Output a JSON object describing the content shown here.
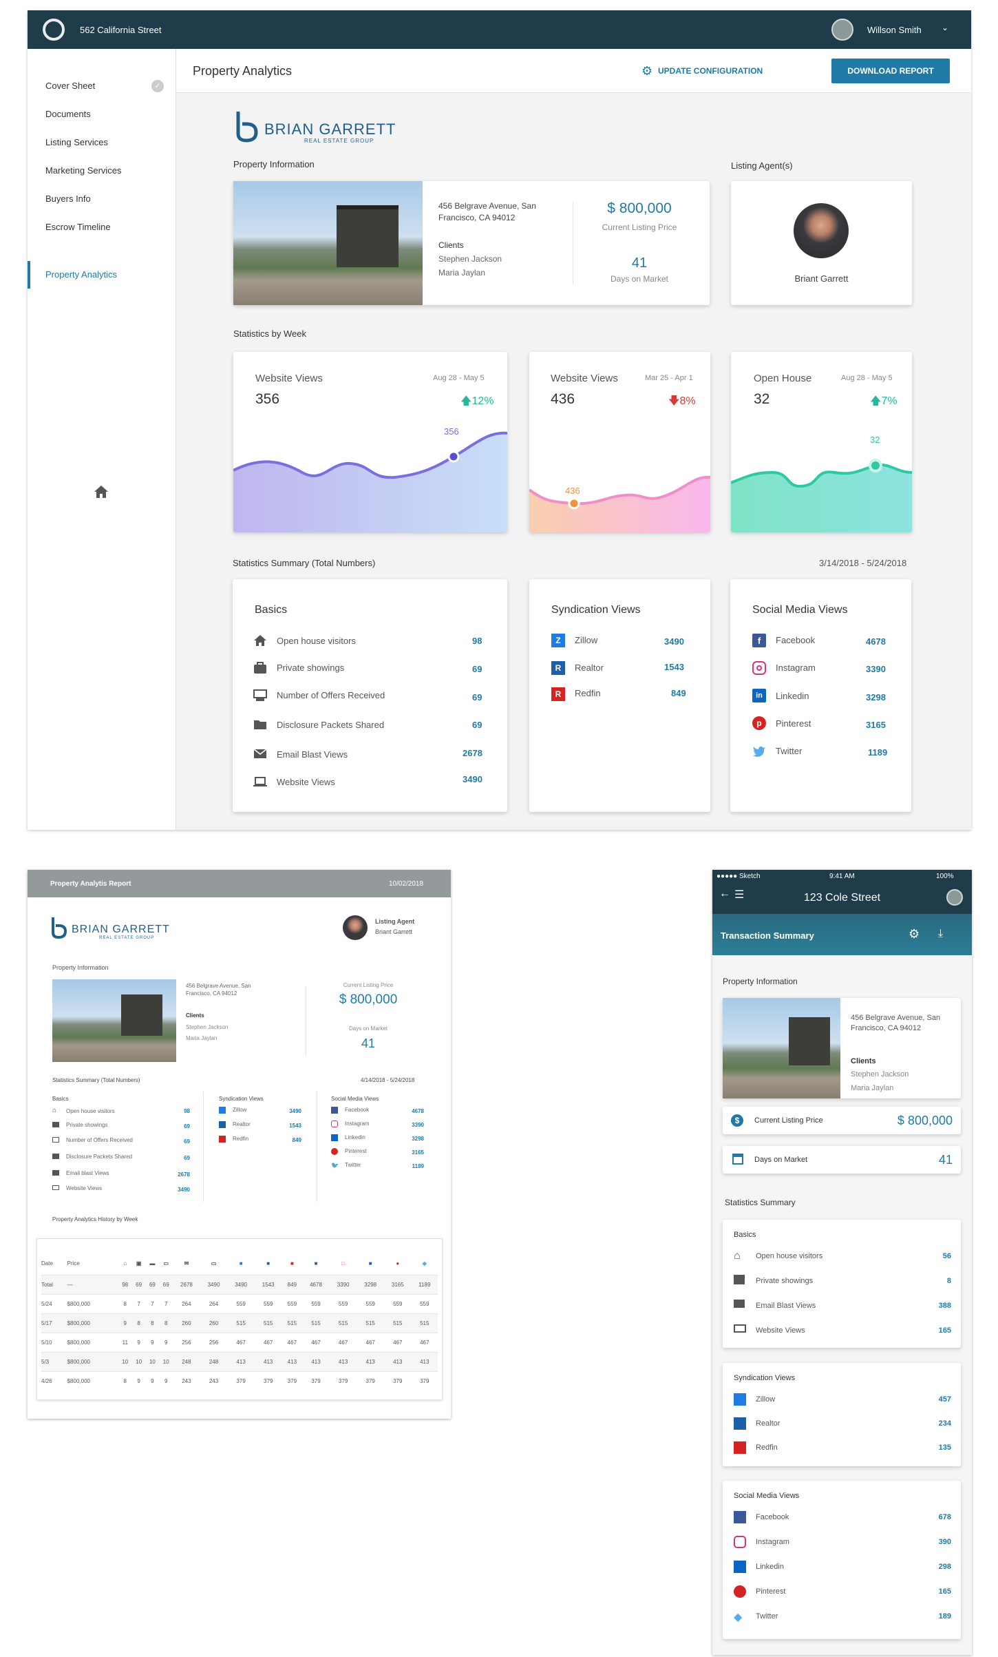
{
  "desktop": {
    "topbar": {
      "address": "562 California Street",
      "user": "Willson Smith"
    },
    "sidebar": {
      "items": [
        {
          "label": "Cover Sheet"
        },
        {
          "label": "Documents"
        },
        {
          "label": "Listing Services"
        },
        {
          "label": "Marketing Services"
        },
        {
          "label": "Buyers Info"
        },
        {
          "label": "Escrow Timeline"
        },
        {
          "label": "Property Analytics"
        }
      ]
    },
    "header": {
      "title": "Property Analytics",
      "config_label": "UPDATE CONFIGURATION",
      "download_label": "DOWNLOAD REPORT"
    },
    "brand": {
      "name": "BRIAN GARRETT",
      "sub": "REAL ESTATE GROUP"
    },
    "property": {
      "section": "Property Information",
      "address": "456 Belgrave Avenue, San Francisco, CA 94012",
      "clients_label": "Clients",
      "client1": "Stephen Jackson",
      "client2": "Maria Jaylan",
      "price": "$ 800,000",
      "price_label": "Current Listing Price",
      "days": "41",
      "days_label": "Days on Market"
    },
    "agent": {
      "section": "Listing Agent(s)",
      "name": "Briant Garrett"
    },
    "weekly": {
      "section": "Statistics by Week",
      "cards": [
        {
          "title": "Website Views",
          "range": "Aug 28 - May 5",
          "value": "356",
          "change": "12%",
          "point": "356"
        },
        {
          "title": "Website Views",
          "range": "Mar 25 - Apr 1",
          "value": "436",
          "change": "8%",
          "point": "436"
        },
        {
          "title": "Open House",
          "range": "Aug 28 - May 5",
          "value": "32",
          "change": "7%",
          "point": "32"
        }
      ]
    },
    "summary": {
      "section": "Statistics Summary (Total Numbers)",
      "range": "3/14/2018 - 5/24/2018",
      "basics": {
        "title": "Basics",
        "rows": [
          {
            "label": "Open house visitors",
            "value": "98"
          },
          {
            "label": "Private showings",
            "value": "69"
          },
          {
            "label": "Number of Offers Received",
            "value": "69"
          },
          {
            "label": "Disclosure Packets Shared",
            "value": "69"
          },
          {
            "label": "Email Blast Views",
            "value": "2678"
          },
          {
            "label": "Website Views",
            "value": "3490"
          }
        ]
      },
      "syndication": {
        "title": "Syndication Views",
        "rows": [
          {
            "label": "Zillow",
            "value": "3490"
          },
          {
            "label": "Realtor",
            "value": "1543"
          },
          {
            "label": "Redfin",
            "value": "849"
          }
        ]
      },
      "social": {
        "title": "Social Media Views",
        "rows": [
          {
            "label": "Facebook",
            "value": "4678"
          },
          {
            "label": "Instagram",
            "value": "3390"
          },
          {
            "label": "Linkedin",
            "value": "3298"
          },
          {
            "label": "Pinterest",
            "value": "3165"
          },
          {
            "label": "Twitter",
            "value": "1189"
          }
        ]
      }
    }
  },
  "report": {
    "header": {
      "title": "Property Analytis Report",
      "date": "10/02/2018"
    },
    "agent_label": "Listing Agent",
    "agent_name": "Briant Garrett",
    "prop_section": "Property Information",
    "address": "456 Belgrave Avenue, San Francisco, CA 94012",
    "clients_label": "Clients",
    "client1": "Stephen Jackson",
    "client2": "Maria Jaylan",
    "price_label": "Current Listing Price",
    "price": "$ 800,000",
    "days_label": "Days on Market",
    "days": "41",
    "summary_section": "Statistics Summary (Total Numbers)",
    "summary_range": "4/14/2018 - 5/24/2018",
    "basics_title": "Basics",
    "basics": [
      {
        "label": "Open house visitors",
        "value": "98"
      },
      {
        "label": "Private showings",
        "value": "69"
      },
      {
        "label": "Number of Offers Received",
        "value": "69"
      },
      {
        "label": "Disclosure Packets Shared",
        "value": "69"
      },
      {
        "label": "Email blast Views",
        "value": "2678"
      },
      {
        "label": "Website Views",
        "value": "3490"
      }
    ],
    "synd_title": "Syndication Views",
    "synd": [
      {
        "label": "Zillow",
        "value": "3490"
      },
      {
        "label": "Realtor",
        "value": "1543"
      },
      {
        "label": "Redfin",
        "value": "849"
      }
    ],
    "social_title": "Social Media Views",
    "social": [
      {
        "label": "Facebook",
        "value": "4678"
      },
      {
        "label": "Instagram",
        "value": "3390"
      },
      {
        "label": "Linkedin",
        "value": "3298"
      },
      {
        "label": "Pinterest",
        "value": "3165"
      },
      {
        "label": "Twitter",
        "value": "1189"
      }
    ],
    "history_section": "Property Analytics History by Week",
    "table": {
      "col_date": "Date",
      "col_price": "Price",
      "rows": [
        [
          "Total",
          "—",
          "98",
          "69",
          "69",
          "69",
          "2678",
          "3490",
          "3490",
          "1543",
          "849",
          "4678",
          "3390",
          "3298",
          "3165",
          "1189"
        ],
        [
          "5/24",
          "$800,000",
          "8",
          "7",
          "7",
          "7",
          "264",
          "264",
          "559",
          "559",
          "559",
          "559",
          "559",
          "559",
          "559",
          "559"
        ],
        [
          "5/17",
          "$800,000",
          "9",
          "8",
          "8",
          "8",
          "260",
          "260",
          "515",
          "515",
          "515",
          "515",
          "515",
          "515",
          "515",
          "515"
        ],
        [
          "5/10",
          "$800,000",
          "11",
          "9",
          "9",
          "9",
          "256",
          "256",
          "467",
          "467",
          "467",
          "467",
          "467",
          "467",
          "467",
          "467"
        ],
        [
          "5/3",
          "$800,000",
          "10",
          "10",
          "10",
          "10",
          "248",
          "248",
          "413",
          "413",
          "413",
          "413",
          "413",
          "413",
          "413",
          "413"
        ],
        [
          "4/26",
          "$800,000",
          "8",
          "9",
          "9",
          "9",
          "243",
          "243",
          "379",
          "379",
          "379",
          "379",
          "379",
          "379",
          "379",
          "379"
        ]
      ]
    }
  },
  "mobile": {
    "status": {
      "carrier": "●●●●● Sketch",
      "time": "9:41 AM",
      "battery": "100%"
    },
    "title": "123 Cole Street",
    "subtitle": "Transaction Summary",
    "prop_section": "Property Information",
    "address": "456 Belgrave Avenue, San Francisco, CA 94012",
    "clients_label": "Clients",
    "client1": "Stephen Jackson",
    "client2": "Maria Jaylan",
    "price_label": "Current Listing Price",
    "price": "$ 800,000",
    "days_label": "Days on Market",
    "days": "41",
    "stats_section": "Statistics Summary",
    "basics_title": "Basics",
    "basics": [
      {
        "label": "Open house visitors",
        "value": "56"
      },
      {
        "label": "Private showings",
        "value": "8"
      },
      {
        "label": "Email Blast Views",
        "value": "388"
      },
      {
        "label": "Website Views",
        "value": "165"
      }
    ],
    "synd_title": "Syndication Views",
    "synd": [
      {
        "label": "Zillow",
        "value": "457"
      },
      {
        "label": "Realtor",
        "value": "234"
      },
      {
        "label": "Redfin",
        "value": "135"
      }
    ],
    "social_title": "Social Media Views",
    "social": [
      {
        "label": "Facebook",
        "value": "678"
      },
      {
        "label": "Instagram",
        "value": "390"
      },
      {
        "label": "Linkedin",
        "value": "298"
      },
      {
        "label": "Pinterest",
        "value": "165"
      },
      {
        "label": "Twitter",
        "value": "189"
      }
    ]
  }
}
